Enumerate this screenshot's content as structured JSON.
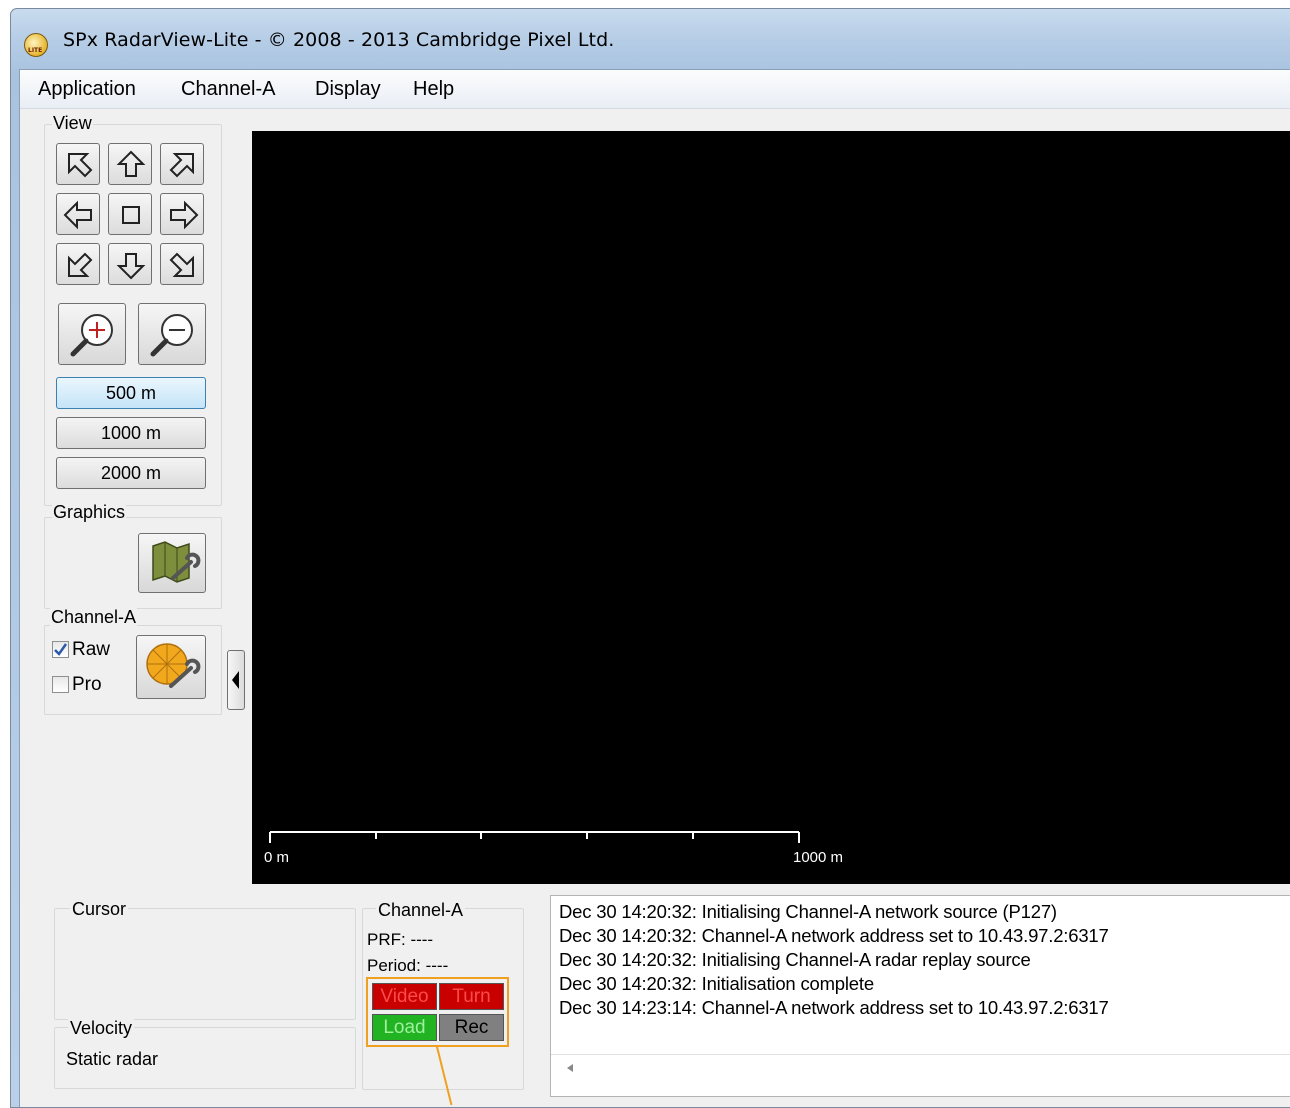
{
  "window": {
    "title": "SPx RadarView-Lite - © 2008 - 2013 Cambridge Pixel Ltd.",
    "icon_text": "LITE"
  },
  "menu": [
    "Application",
    "Channel-A",
    "Display",
    "Help"
  ],
  "view": {
    "label": "View",
    "nav_buttons": [
      "pan-up-left",
      "pan-up",
      "pan-up-right",
      "pan-left",
      "center",
      "pan-right",
      "pan-down-left",
      "pan-down",
      "pan-down-right"
    ],
    "zoom_in_icon": "zoom-in-icon",
    "zoom_out_icon": "zoom-out-icon",
    "ranges": [
      "500 m",
      "1000 m",
      "2000 m"
    ],
    "active_range": "500 m"
  },
  "graphics": {
    "label": "Graphics",
    "button_icon": "map-wrench-icon"
  },
  "channel": {
    "label": "Channel-A",
    "raw_label": "Raw",
    "raw_checked": true,
    "pro_label": "Pro",
    "pro_checked": false,
    "button_icon": "radar-wrench-icon"
  },
  "collapse_icon": "chevron-left-icon",
  "radar_scale": {
    "start": "0 m",
    "end": "1000 m"
  },
  "cursor_panel": {
    "label": "Cursor",
    "velocity_label": "Velocity",
    "velocity_value": "Static radar"
  },
  "channel_status": {
    "label": "Channel-A",
    "prf": "PRF: ----",
    "period": "Period: ----",
    "video": "Video",
    "turn": "Turn",
    "load": "Load",
    "rec": "Rec",
    "colors": {
      "red": "#c80000",
      "green": "#22b322",
      "gray": "#808080",
      "highlight": "#f0a020"
    }
  },
  "log": [
    "Dec 30 14:20:32: Initialising Channel-A network source (P127)",
    "Dec 30 14:20:32: Channel-A network address set to 10.43.97.2:6317",
    "Dec 30 14:20:32: Initialising Channel-A radar replay source",
    "Dec 30 14:20:32: Initialisation complete",
    "Dec 30 14:23:14: Channel-A network address set to 10.43.97.2:6317"
  ],
  "log_scroll_icon": "scroll-left-icon"
}
